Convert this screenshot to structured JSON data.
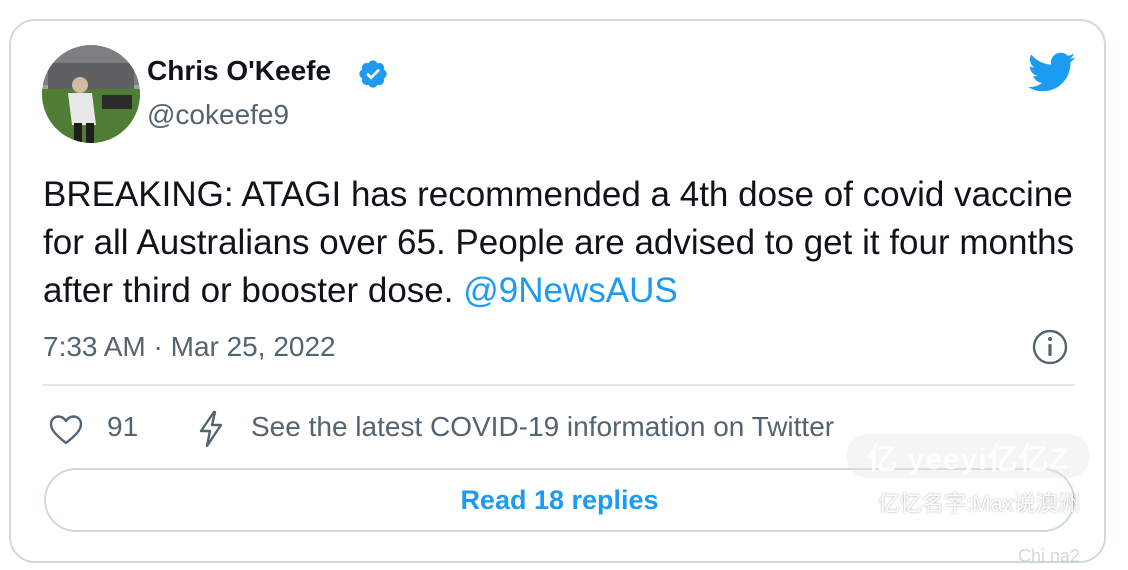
{
  "author": {
    "name": "Chris O'Keefe",
    "handle": "@cokeefe9",
    "avatar_icon": "avatar-photo",
    "verified_icon": "verified-badge-icon"
  },
  "tweet": {
    "text_main": "BREAKING: ATAGI has recommended a 4th dose of covid vaccine for all Australians over 65. People are advised to get it four months after third or booster dose.",
    "mention": "@9NewsAUS",
    "timestamp": "7:33 AM · Mar 25, 2022"
  },
  "actions": {
    "like_count": "91",
    "covid_info_label": "See the latest COVID-19 information on Twitter",
    "read_replies_label": "Read 18 replies"
  },
  "watermark": {
    "logo": "亿 yeeyi亿亿Z",
    "text": "亿忆名字:Max说澳洲",
    "corner": "Chi na2"
  },
  "colors": {
    "accent": "#1d9bf0",
    "text": "#0f1419",
    "muted": "#536471",
    "border": "#cfd9de"
  }
}
